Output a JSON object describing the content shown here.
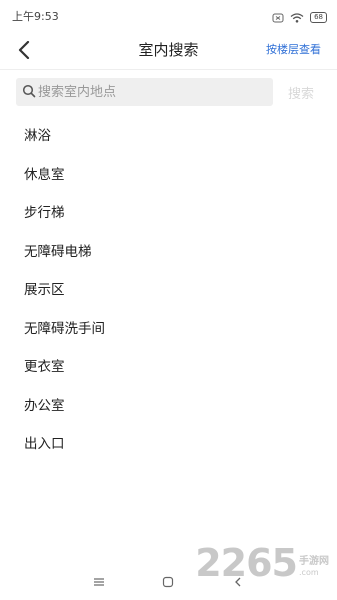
{
  "status_bar": {
    "time": "上午9:53",
    "battery_level": "68",
    "icons": [
      "alarm-icon",
      "wifi-icon",
      "battery-icon"
    ]
  },
  "header": {
    "title": "室内搜索",
    "floor_link_label": "按楼层查看",
    "back_icon": "chevron-left-icon",
    "link_color": "#2f6fd6"
  },
  "search": {
    "placeholder": "搜索室内地点",
    "value": "",
    "button_label": "搜索"
  },
  "locations": [
    {
      "label": "淋浴"
    },
    {
      "label": "休息室"
    },
    {
      "label": "步行梯"
    },
    {
      "label": "无障碍电梯"
    },
    {
      "label": "展示区"
    },
    {
      "label": "无障碍洗手间"
    },
    {
      "label": "更衣室"
    },
    {
      "label": "办公室"
    },
    {
      "label": "出入口"
    }
  ],
  "system_nav": {
    "icons": [
      "menu-icon",
      "home-icon",
      "back-icon"
    ]
  },
  "watermark": {
    "main": "2265",
    "cn": "手游网",
    "en": ".com"
  }
}
